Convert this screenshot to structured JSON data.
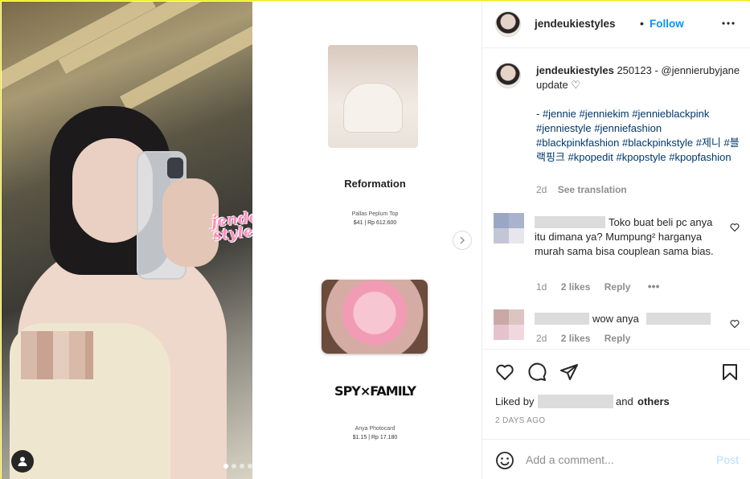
{
  "header": {
    "username": "jendeukiestyles",
    "separator": "•",
    "follow_label": "Follow",
    "more_icon": "more-horizontal-icon"
  },
  "photo": {
    "watermark": "jendeuk styles"
  },
  "product": {
    "brand": "Reformation",
    "item_name": "Pallas Peplum Top",
    "item_price": "$41 | Rp 612.600",
    "card_logo": "SPY×FAMILY",
    "card_name": "Anya Photocard",
    "card_price": "$1.15 | Rp 17.180"
  },
  "caption": {
    "username": "jendeukiestyles",
    "text": "250123 - @jennierubyjane update ♡",
    "hashtags": "- #jennie #jenniekim #jennieblackpink #jenniestyle #jenniefashion #blackpinkfashion #blackpinkstyle #제니 #블랙핑크 #kpopedit #kpopstyle #kpopfashion",
    "time": "2d",
    "see_translation": "See translation"
  },
  "comments": [
    {
      "text": "Toko buat beli pc anya itu dimana ya? Mumpung² harganya murah sama bisa couplean sama bias.",
      "time": "1d",
      "likes": "2 likes",
      "reply": "Reply",
      "more": "•••"
    },
    {
      "text": "wow anya",
      "time": "2d",
      "likes": "2 likes",
      "reply": "Reply"
    }
  ],
  "actions": {
    "liked_by": "Liked by",
    "and": "and",
    "others": "others",
    "date": "2 DAYS AGO"
  },
  "add_comment": {
    "placeholder": "Add a comment...",
    "post_label": "Post"
  },
  "colors": {
    "link": "#0095f6",
    "hashtag": "#00376b",
    "muted": "#8e8e8e",
    "post_disabled": "#b2dffc"
  }
}
